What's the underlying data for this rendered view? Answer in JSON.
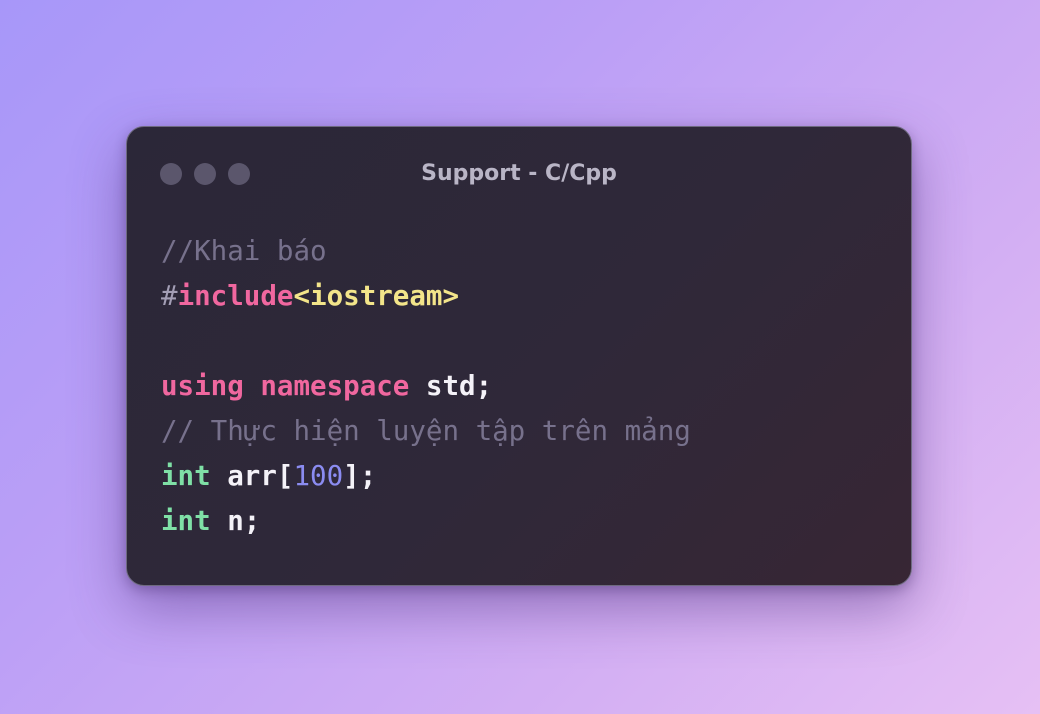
{
  "window": {
    "title": "Support - C/Cpp",
    "controls": [
      "window-dot",
      "window-dot",
      "window-dot"
    ]
  },
  "code": {
    "language": "C/Cpp",
    "lines": [
      [
        {
          "text": "//Khai báo",
          "kind": "comment"
        }
      ],
      [
        {
          "text": "#",
          "kind": "hash"
        },
        {
          "text": "include",
          "kind": "keyword"
        },
        {
          "text": "<iostream>",
          "kind": "header"
        }
      ],
      [],
      [
        {
          "text": "using",
          "kind": "keyword"
        },
        {
          "text": " ",
          "kind": "plain"
        },
        {
          "text": "namespace",
          "kind": "keyword"
        },
        {
          "text": " std;",
          "kind": "plain"
        }
      ],
      [
        {
          "text": "// Thực hiện luyện tập trên mảng",
          "kind": "comment"
        }
      ],
      [
        {
          "text": "int",
          "kind": "type"
        },
        {
          "text": " arr[",
          "kind": "plain"
        },
        {
          "text": "100",
          "kind": "number"
        },
        {
          "text": "];",
          "kind": "plain"
        }
      ],
      [
        {
          "text": "int",
          "kind": "type"
        },
        {
          "text": " n;",
          "kind": "plain"
        }
      ]
    ]
  },
  "colors": {
    "comment": "#77718c",
    "keyword": "#f0679f",
    "header": "#f3e58a",
    "type": "#7fe0a6",
    "number": "#8b8cf1",
    "plain": "#f4f2f8",
    "window_bg": "#2b2738"
  }
}
